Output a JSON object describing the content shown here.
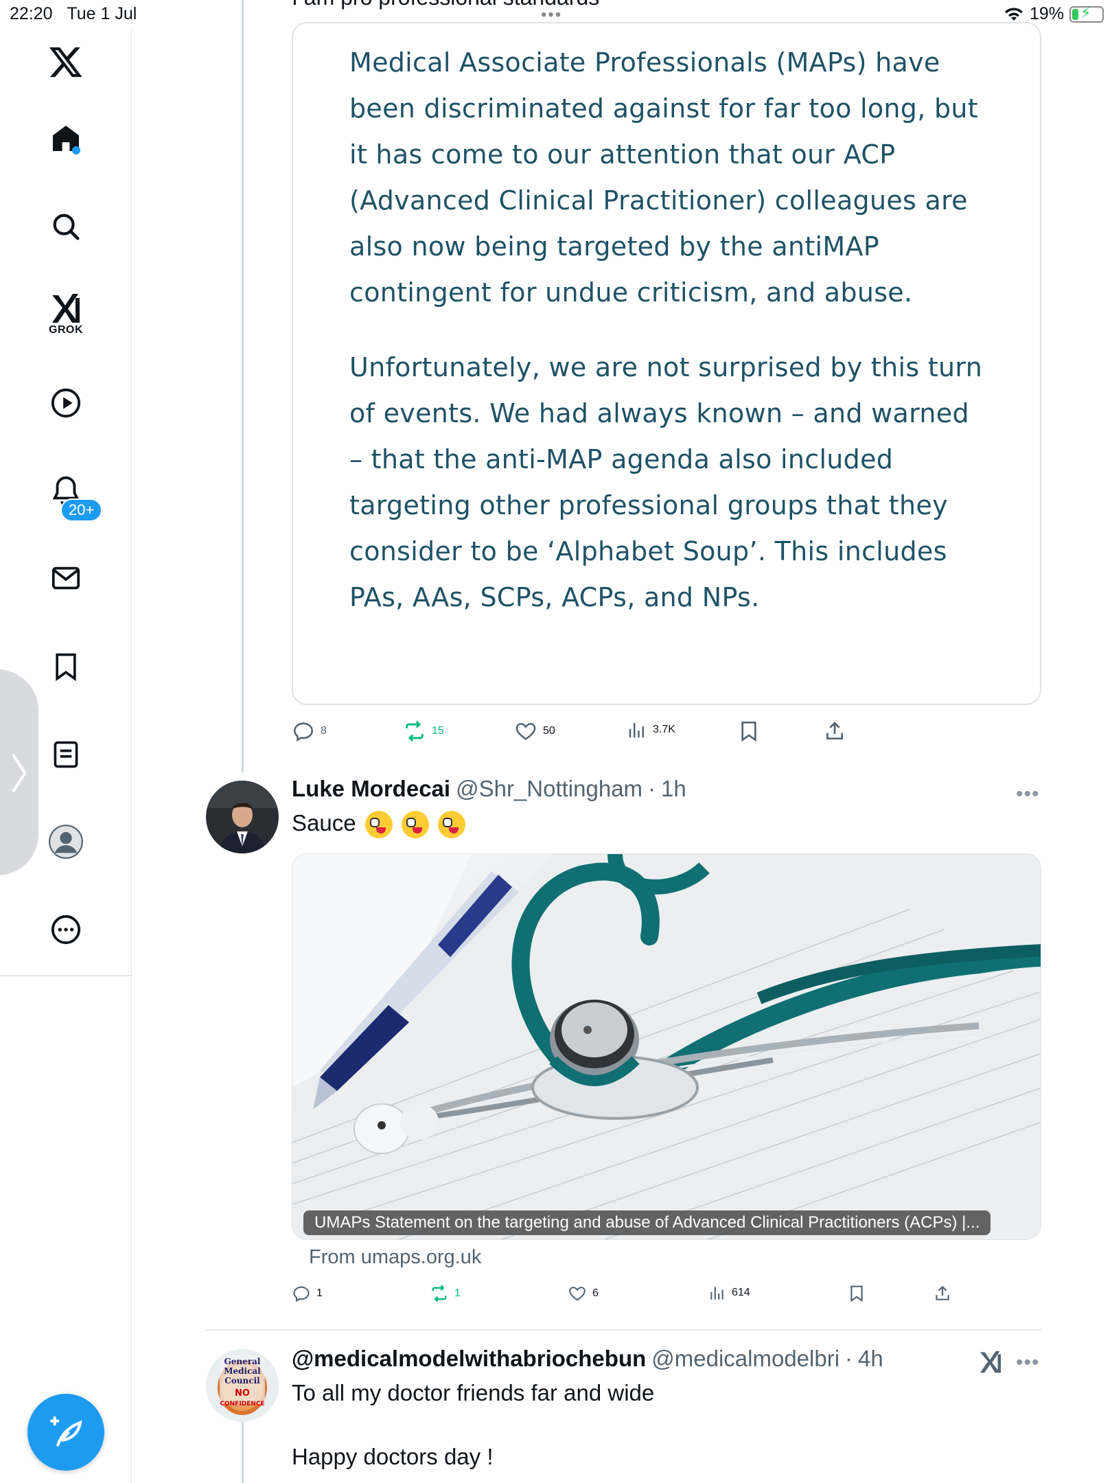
{
  "status_bar": {
    "time": "22:20",
    "date": "Tue 1 Jul",
    "battery": "19%"
  },
  "sidebar": {
    "notifications_badge": "20+",
    "grok_label": "GROK",
    "items": [
      "x-logo",
      "home",
      "search",
      "grok",
      "video",
      "notifications",
      "messages",
      "bookmarks",
      "lists",
      "profile",
      "more"
    ]
  },
  "quote_tweet": {
    "top_cut_text": "I am pro professional standards",
    "paragraphs": [
      "Medical Associate Professionals (MAPs) have been discriminated against for far too long, but it has come to our attention that our ACP (Advanced Clinical Practitioner) colleagues are also now being targeted by the antiMAP contingent for undue criticism, and abuse.",
      "Unfortunately, we are not surprised by this turn of events. We had always known – and warned – that the anti-MAP agenda also included targeting other professional groups that they consider to be ‘Alphabet Soup’. This includes PAs, AAs, SCPs, ACPs, and NPs."
    ],
    "actions": {
      "replies": "8",
      "reposts": "15",
      "likes": "50",
      "views": "3.7K"
    }
  },
  "tweet_luke": {
    "name": "Luke Mordecai",
    "handle": "@Shr_Nottingham",
    "sep": "·",
    "time": "1h",
    "text": "Sauce",
    "media_caption": "UMAPs Statement on the targeting and abuse of Advanced Clinical Practitioners (ACPs)  |...",
    "media_source": "From umaps.org.uk",
    "actions": {
      "replies": "1",
      "reposts": "1",
      "likes": "6",
      "views": "614"
    }
  },
  "tweet_medical": {
    "name": "@medicalmodelwithabriochebun",
    "handle": "@medicalmodelbri",
    "sep": "·",
    "time": "4h",
    "line1": "To all my doctor friends far and wide",
    "line2": "Happy doctors day !",
    "avatar_lines": [
      "General",
      "Medical",
      "Council",
      "NO",
      "CONFIDENCE"
    ]
  },
  "colors": {
    "accent": "#1d9bf0",
    "repost_green": "#00ba7c",
    "quote_text": "#1e5266",
    "stethoscope": "#0f6f73"
  }
}
